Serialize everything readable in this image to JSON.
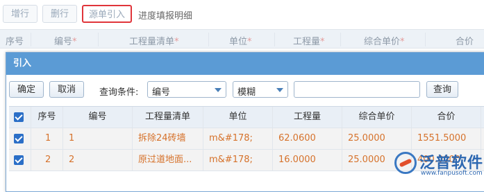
{
  "toolbar": {
    "add_label": "增行",
    "delete_label": "删行",
    "import_label": "源单引入",
    "progress_label": "进度填报明细"
  },
  "background_table": {
    "columns": [
      "序号",
      "编号",
      "工程量清单",
      "单位",
      "工程量",
      "综合单价",
      "合价"
    ],
    "required_mark": "*"
  },
  "dialog": {
    "title": "引入",
    "confirm_label": "确定",
    "cancel_label": "取消",
    "query_label": "查询条件:",
    "field_select": "编号",
    "match_select": "模糊",
    "query_input": "",
    "query_button": "查询",
    "columns": [
      "序号",
      "编号",
      "工程量清单",
      "单位",
      "工程量",
      "综合单价",
      "合价"
    ],
    "rows": [
      {
        "checked": true,
        "seq": "1",
        "code": "1",
        "item": "拆除24砖墙",
        "unit": "m&#178;",
        "qty": "62.0600",
        "price": "25.0000",
        "total": "1551.5000"
      },
      {
        "checked": true,
        "seq": "2",
        "code": "2",
        "item": "原过道地面...",
        "unit": "m&#178;",
        "qty": "16.0000",
        "price": "25.0000",
        "total": "400.0000"
      }
    ]
  },
  "watermark": {
    "brand": "泛普软件",
    "url": "www.fanpusoft.com"
  },
  "colors": {
    "dialog_header": "#5b9bd5",
    "highlight_border": "#e0343a",
    "data_text": "#d6722b",
    "checkbox": "#2b6fc7"
  }
}
